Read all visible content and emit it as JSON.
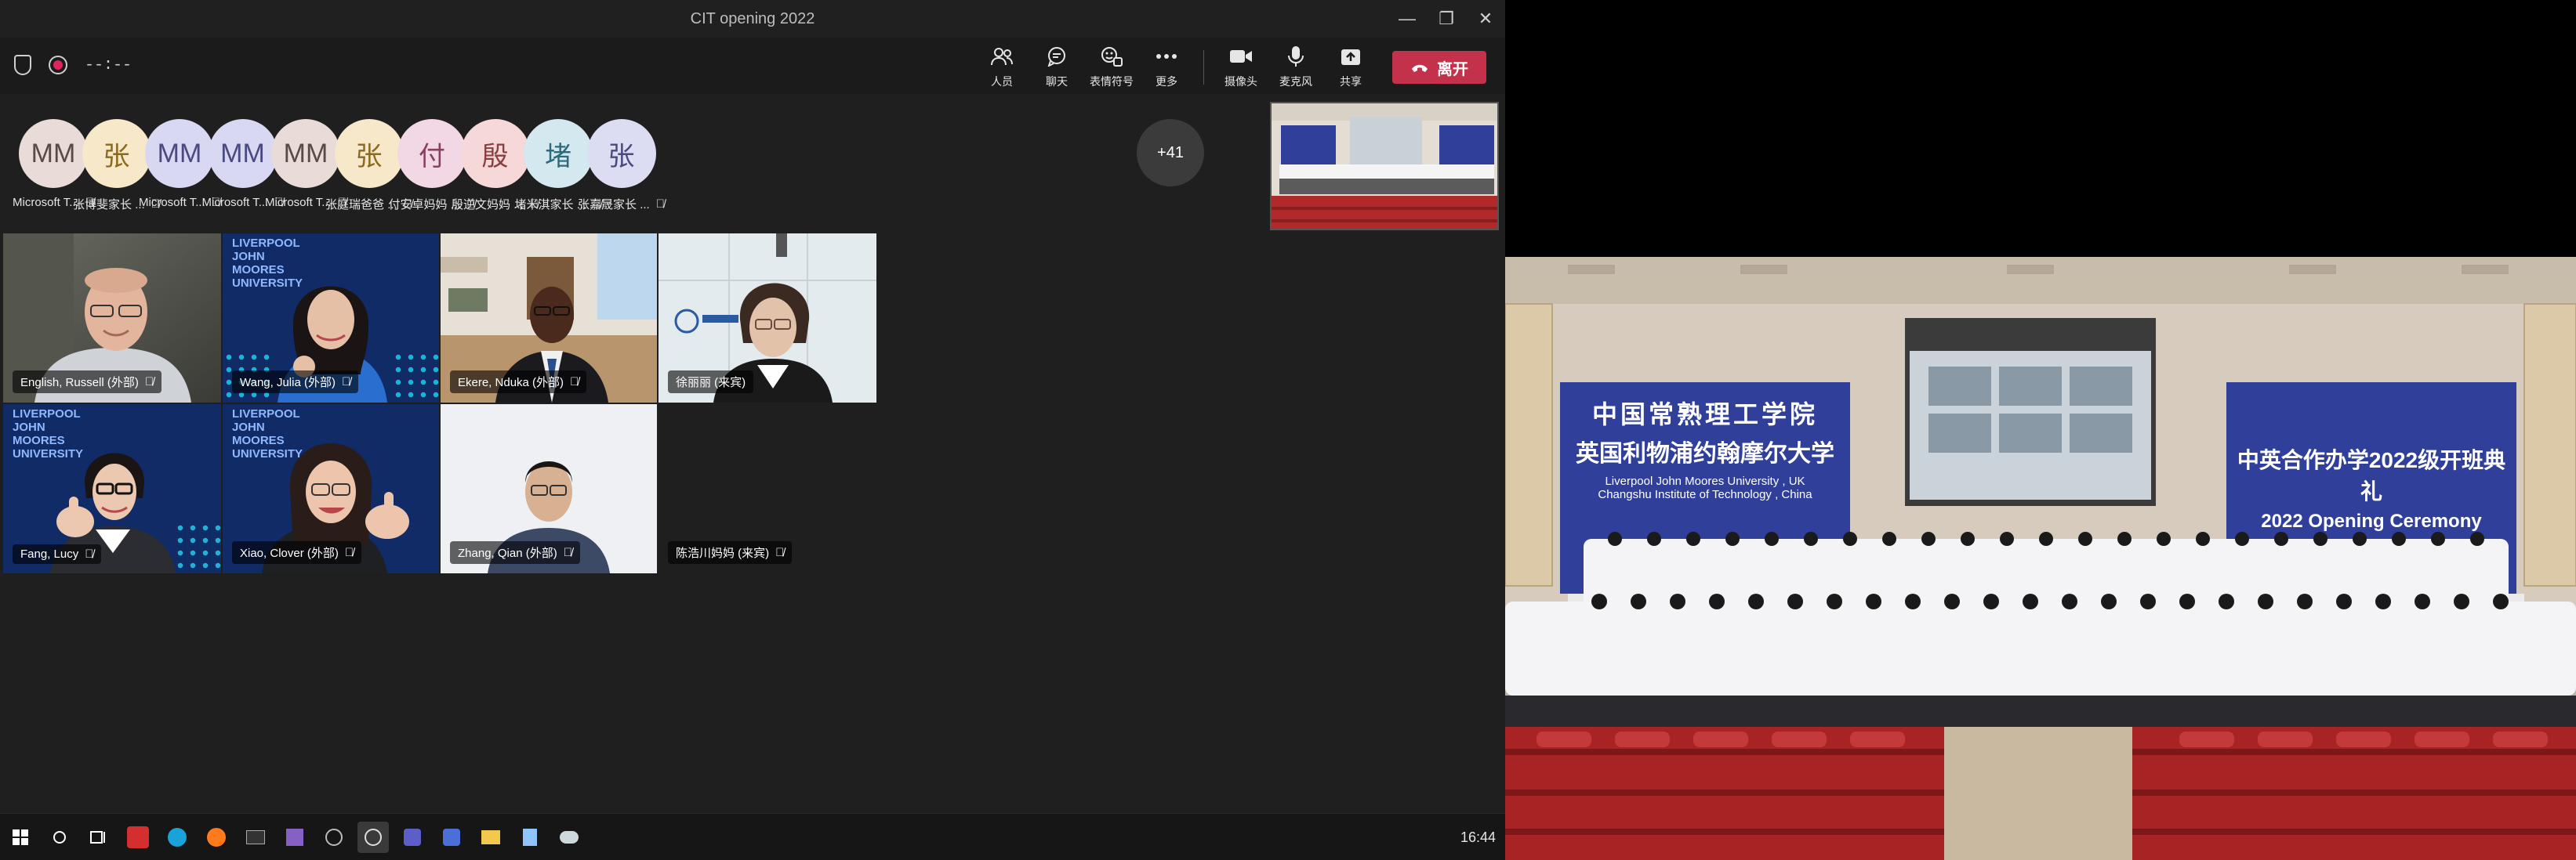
{
  "window": {
    "title": "CIT opening 2022",
    "controls": [
      "—",
      "❐",
      "✕"
    ]
  },
  "toolbar": {
    "timer": "--:--",
    "buttons": [
      {
        "label": "人员"
      },
      {
        "label": "聊天"
      },
      {
        "label": "表情符号"
      },
      {
        "label": "更多"
      },
      {
        "label": "摄像头"
      },
      {
        "label": "麦克风"
      },
      {
        "label": "共享"
      }
    ],
    "leave_label": "离开",
    "leave_color": "#c4314b"
  },
  "participants": [
    {
      "initials": "MM",
      "name": "Microsoft T...",
      "bg": "#e9dbd7",
      "fg": "#5a4a46"
    },
    {
      "initials": "张",
      "name": "张博斐家长 ...",
      "bg": "#f6e8c8",
      "fg": "#8a6a1e"
    },
    {
      "initials": "MM",
      "name": "Microsoft T...",
      "bg": "#d9d8f2",
      "fg": "#4a4a80"
    },
    {
      "initials": "MM",
      "name": "Microsoft T...",
      "bg": "#d9d8f2",
      "fg": "#4a4a80"
    },
    {
      "initials": "MM",
      "name": "Microsoft T...",
      "bg": "#e9dbd7",
      "fg": "#5a4a46"
    },
    {
      "initials": "张",
      "name": "张庭瑞爸爸 ...",
      "bg": "#f6e8c8",
      "fg": "#8a6a1e"
    },
    {
      "initials": "付",
      "name": "付安卓妈妈 ...",
      "bg": "#f1d8e4",
      "fg": "#8a3e62"
    },
    {
      "initials": "殷",
      "name": "殷逆文妈妈 ...",
      "bg": "#f6d8d8",
      "fg": "#8a3e3e"
    },
    {
      "initials": "堵",
      "name": "堵米淇家长 ...",
      "bg": "#d3e8ef",
      "fg": "#2e6a7e"
    },
    {
      "initials": "张",
      "name": "张嘉晟家长 ...",
      "bg": "#dcdcf2",
      "fg": "#4a4a80"
    }
  ],
  "overflow_count": "+41",
  "videos": [
    {
      "name": "English, Russell (外部)",
      "mic_muted": true
    },
    {
      "name": "Wang, Julia (外部)",
      "mic_muted": true,
      "org": "LIVERPOOL JOHN MOORES UNIVERSITY"
    },
    {
      "name": "Ekere, Nduka (外部)",
      "mic_muted": true
    },
    {
      "name": "徐丽丽 (来宾)",
      "mic_muted": false
    },
    {
      "name": "Fang, Lucy",
      "mic_muted": true,
      "org": "LIVERPOOL JOHN MOORES UNIVERSITY"
    },
    {
      "name": "Xiao, Clover (外部)",
      "mic_muted": true,
      "org": "LIVERPOOL JOHN MOORES UNIVERSITY"
    },
    {
      "name": "Zhang, Qian (外部)",
      "mic_muted": true
    },
    {
      "name": "陈浩川妈妈 (来宾)",
      "mic_muted": true
    }
  ],
  "taskbar": {
    "clock": "16:44"
  },
  "ceremony": {
    "banner_left_cn1": "中国常熟理工学院",
    "banner_left_cn2": "英国利物浦约翰摩尔大学",
    "banner_left_en1": "Liverpool John Moores University , UK",
    "banner_left_en2": "Changshu Institute of Technology , China",
    "banner_right_cn": "中英合作办学2022级开班典礼",
    "banner_right_en": "2022 Opening Ceremony",
    "banner_color": "#2f3f9a"
  }
}
